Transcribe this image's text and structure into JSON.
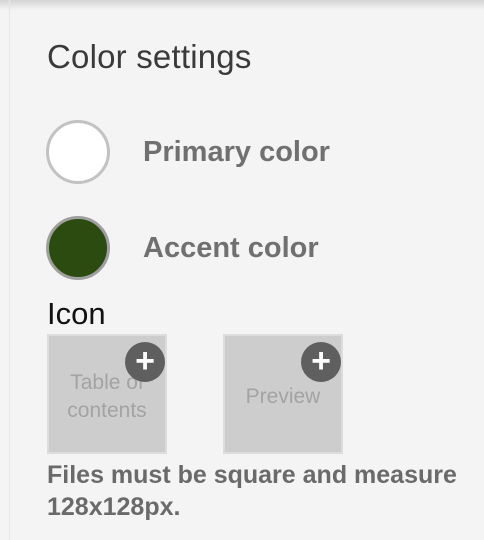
{
  "section": {
    "title": "Color settings"
  },
  "colors": {
    "primary": {
      "label": "Primary color",
      "value": "#ffffff"
    },
    "accent": {
      "label": "Accent color",
      "value": "#2b4b10"
    }
  },
  "icon": {
    "heading": "Icon",
    "tiles": [
      {
        "label": "Table of contents",
        "badge_icon": "plus-icon"
      },
      {
        "label": "Preview",
        "badge_icon": "plus-icon"
      }
    ],
    "add_symbol": "+",
    "help_text": "Files must be square and measure 128x128px."
  }
}
